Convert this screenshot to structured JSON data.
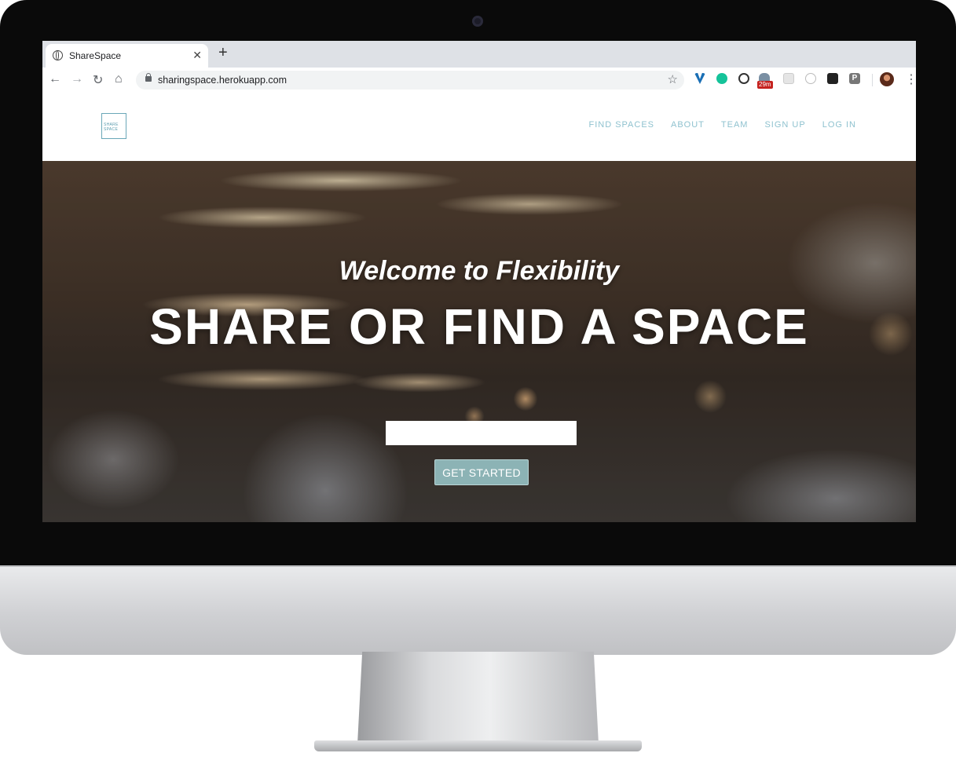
{
  "browser": {
    "tab": {
      "title": "ShareSpace",
      "close_glyph": "✕",
      "icon": "globe-icon"
    },
    "new_tab_glyph": "+",
    "toolbar": {
      "back_glyph": "←",
      "forward_glyph": "→",
      "reload_glyph": "↻",
      "home_glyph": "⌂",
      "url": "sharingspace.herokuapp.com",
      "star_glyph": "☆",
      "menu_glyph": "⋮"
    },
    "extensions": [
      {
        "name": "vimeo-extension-icon",
        "color": "#1a6fb5"
      },
      {
        "name": "grammarly-extension-icon",
        "color": "#15c39a"
      },
      {
        "name": "onepassword-extension-icon",
        "color": "#333333"
      },
      {
        "name": "timer-extension-icon",
        "color": "#c5221f",
        "badge": "29m"
      },
      {
        "name": "grid-extension-icon",
        "color": "#cccccc"
      },
      {
        "name": "clock-extension-icon",
        "color": "#bbbbbb"
      },
      {
        "name": "camera-extension-icon",
        "color": "#222222"
      },
      {
        "name": "p-extension-icon",
        "color": "#777777",
        "letter": "P"
      }
    ]
  },
  "site": {
    "logo": {
      "line1": "SHARE",
      "line2": "SPACE"
    },
    "nav": [
      "FIND SPACES",
      "ABOUT",
      "TEAM",
      "SIGN UP",
      "LOG IN"
    ],
    "hero": {
      "welcome": "Welcome to Flexibility",
      "headline": "SHARE OR FIND A SPACE",
      "search_value": "",
      "cta_label": "GET STARTED"
    },
    "colors": {
      "accent": "#8fc2cf",
      "cta": "#8cb3b5"
    }
  }
}
